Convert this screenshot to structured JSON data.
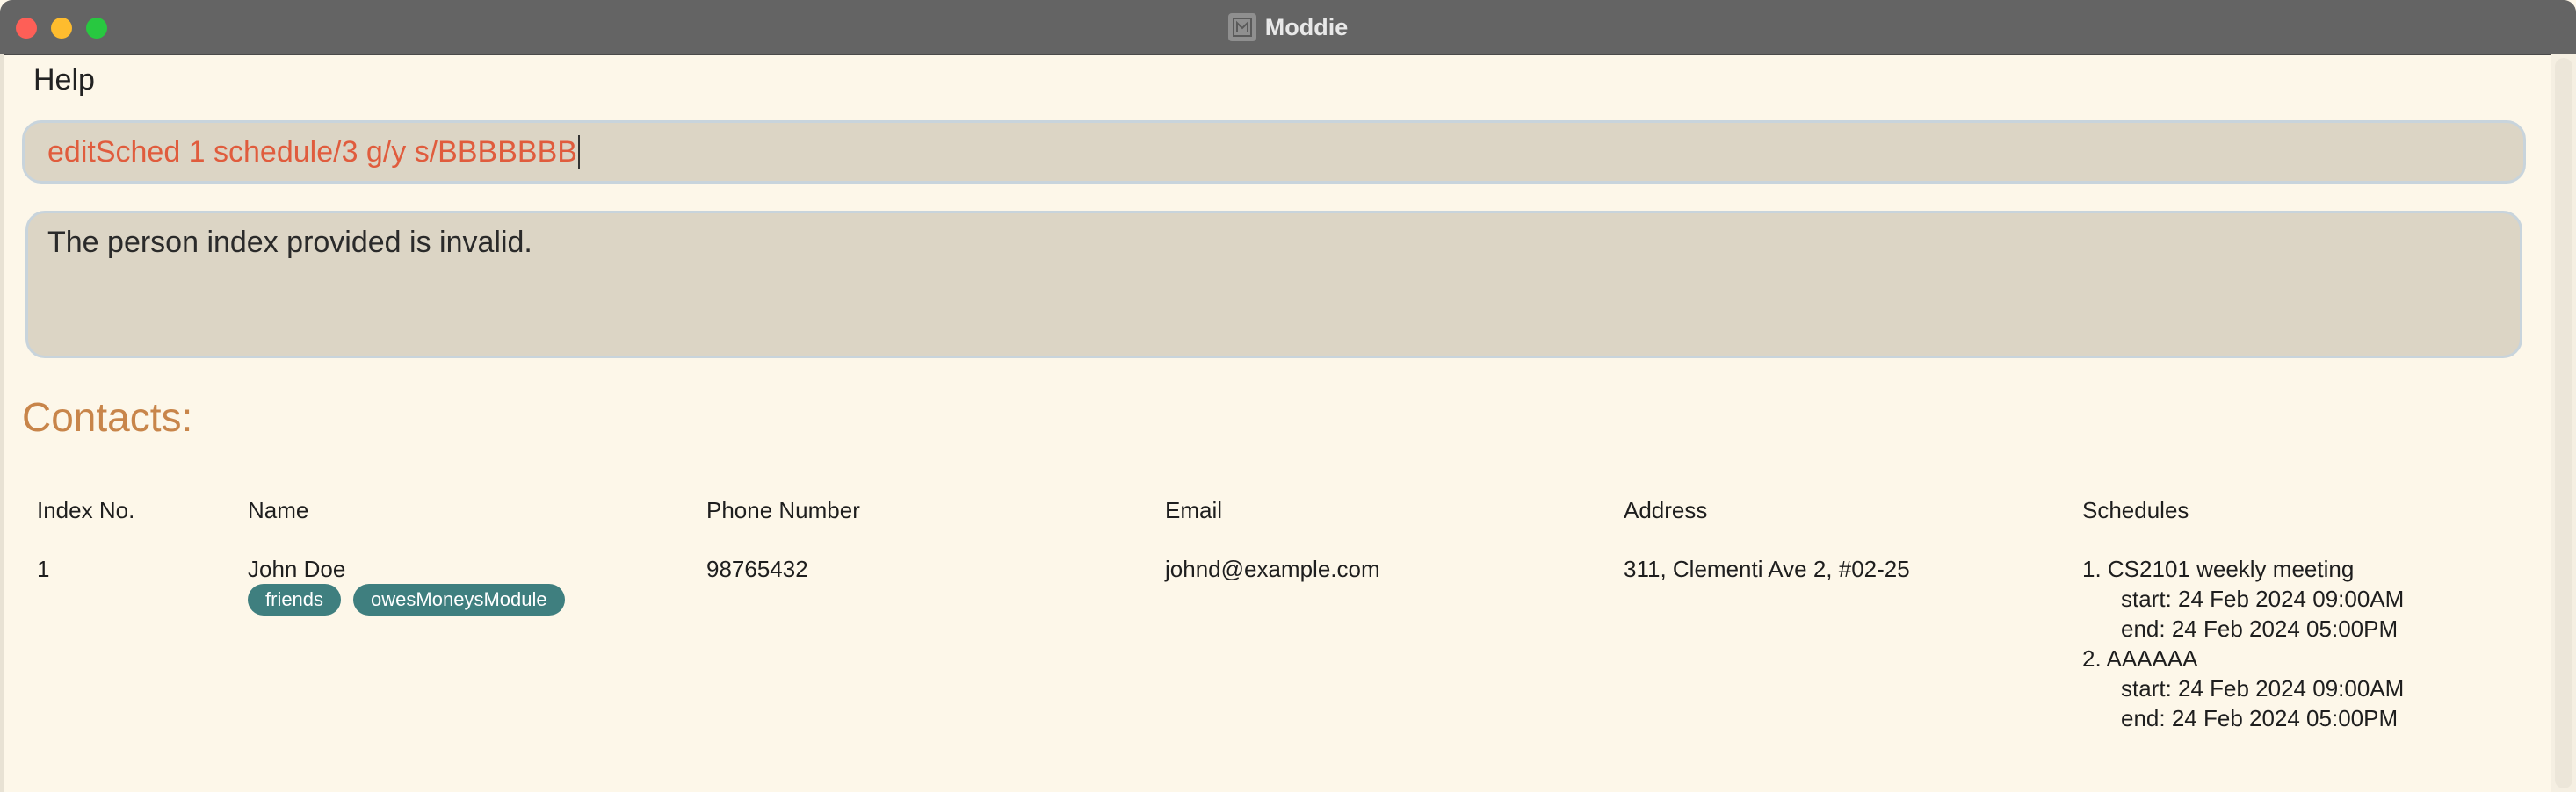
{
  "window": {
    "title": "Moddie",
    "icon": "app-logo-icon"
  },
  "menu": {
    "help_label": "Help"
  },
  "command_box": {
    "value": "editSched 1 schedule/3 g/y s/BBBBBBB",
    "text_color": "#e05c3d"
  },
  "result_box": {
    "message": "The person index provided is invalid."
  },
  "contacts": {
    "heading": "Contacts:",
    "heading_color": "#c8854a",
    "columns": {
      "index": "Index No.",
      "name": "Name",
      "phone": "Phone Number",
      "email": "Email",
      "address": "Address",
      "schedules": "Schedules"
    },
    "rows": [
      {
        "index": "1",
        "name": "John Doe",
        "tags": [
          "friends",
          "owesMoneysModule"
        ],
        "phone": "98765432",
        "email": "johnd@example.com",
        "address": "311, Clementi Ave 2, #02-25",
        "schedules": [
          {
            "title": "1. CS2101 weekly meeting",
            "start": "start: 24 Feb 2024 09:00AM",
            "end": "end: 24 Feb 2024 05:00PM"
          },
          {
            "title": "2. AAAAAA",
            "start": "start: 24 Feb 2024 09:00AM",
            "end": "end: 24 Feb 2024 05:00PM"
          }
        ]
      }
    ],
    "tag_color": "#3f7f7f"
  }
}
